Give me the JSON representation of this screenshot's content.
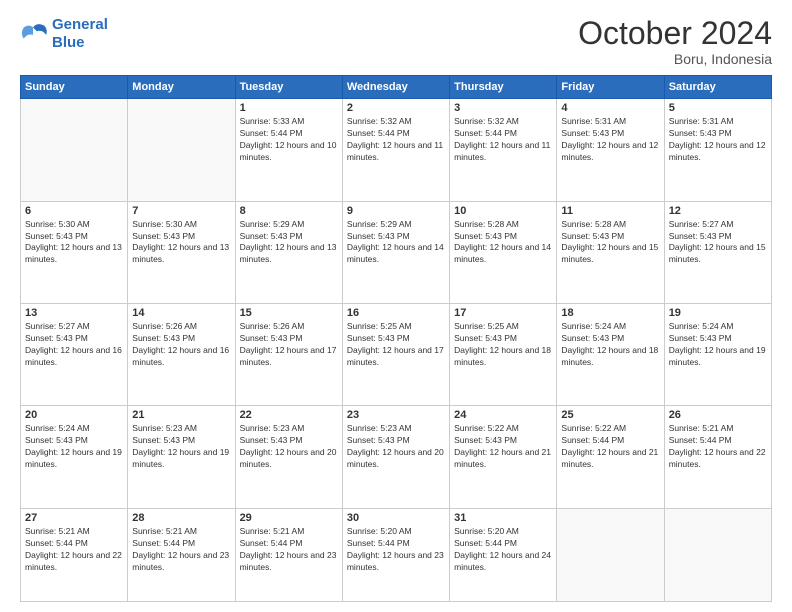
{
  "header": {
    "logo_line1": "General",
    "logo_line2": "Blue",
    "month_title": "October 2024",
    "location": "Boru, Indonesia"
  },
  "days_of_week": [
    "Sunday",
    "Monday",
    "Tuesday",
    "Wednesday",
    "Thursday",
    "Friday",
    "Saturday"
  ],
  "weeks": [
    [
      {
        "day": "",
        "sunrise": "",
        "sunset": "",
        "daylight": ""
      },
      {
        "day": "",
        "sunrise": "",
        "sunset": "",
        "daylight": ""
      },
      {
        "day": "1",
        "sunrise": "Sunrise: 5:33 AM",
        "sunset": "Sunset: 5:44 PM",
        "daylight": "Daylight: 12 hours and 10 minutes."
      },
      {
        "day": "2",
        "sunrise": "Sunrise: 5:32 AM",
        "sunset": "Sunset: 5:44 PM",
        "daylight": "Daylight: 12 hours and 11 minutes."
      },
      {
        "day": "3",
        "sunrise": "Sunrise: 5:32 AM",
        "sunset": "Sunset: 5:44 PM",
        "daylight": "Daylight: 12 hours and 11 minutes."
      },
      {
        "day": "4",
        "sunrise": "Sunrise: 5:31 AM",
        "sunset": "Sunset: 5:43 PM",
        "daylight": "Daylight: 12 hours and 12 minutes."
      },
      {
        "day": "5",
        "sunrise": "Sunrise: 5:31 AM",
        "sunset": "Sunset: 5:43 PM",
        "daylight": "Daylight: 12 hours and 12 minutes."
      }
    ],
    [
      {
        "day": "6",
        "sunrise": "Sunrise: 5:30 AM",
        "sunset": "Sunset: 5:43 PM",
        "daylight": "Daylight: 12 hours and 13 minutes."
      },
      {
        "day": "7",
        "sunrise": "Sunrise: 5:30 AM",
        "sunset": "Sunset: 5:43 PM",
        "daylight": "Daylight: 12 hours and 13 minutes."
      },
      {
        "day": "8",
        "sunrise": "Sunrise: 5:29 AM",
        "sunset": "Sunset: 5:43 PM",
        "daylight": "Daylight: 12 hours and 13 minutes."
      },
      {
        "day": "9",
        "sunrise": "Sunrise: 5:29 AM",
        "sunset": "Sunset: 5:43 PM",
        "daylight": "Daylight: 12 hours and 14 minutes."
      },
      {
        "day": "10",
        "sunrise": "Sunrise: 5:28 AM",
        "sunset": "Sunset: 5:43 PM",
        "daylight": "Daylight: 12 hours and 14 minutes."
      },
      {
        "day": "11",
        "sunrise": "Sunrise: 5:28 AM",
        "sunset": "Sunset: 5:43 PM",
        "daylight": "Daylight: 12 hours and 15 minutes."
      },
      {
        "day": "12",
        "sunrise": "Sunrise: 5:27 AM",
        "sunset": "Sunset: 5:43 PM",
        "daylight": "Daylight: 12 hours and 15 minutes."
      }
    ],
    [
      {
        "day": "13",
        "sunrise": "Sunrise: 5:27 AM",
        "sunset": "Sunset: 5:43 PM",
        "daylight": "Daylight: 12 hours and 16 minutes."
      },
      {
        "day": "14",
        "sunrise": "Sunrise: 5:26 AM",
        "sunset": "Sunset: 5:43 PM",
        "daylight": "Daylight: 12 hours and 16 minutes."
      },
      {
        "day": "15",
        "sunrise": "Sunrise: 5:26 AM",
        "sunset": "Sunset: 5:43 PM",
        "daylight": "Daylight: 12 hours and 17 minutes."
      },
      {
        "day": "16",
        "sunrise": "Sunrise: 5:25 AM",
        "sunset": "Sunset: 5:43 PM",
        "daylight": "Daylight: 12 hours and 17 minutes."
      },
      {
        "day": "17",
        "sunrise": "Sunrise: 5:25 AM",
        "sunset": "Sunset: 5:43 PM",
        "daylight": "Daylight: 12 hours and 18 minutes."
      },
      {
        "day": "18",
        "sunrise": "Sunrise: 5:24 AM",
        "sunset": "Sunset: 5:43 PM",
        "daylight": "Daylight: 12 hours and 18 minutes."
      },
      {
        "day": "19",
        "sunrise": "Sunrise: 5:24 AM",
        "sunset": "Sunset: 5:43 PM",
        "daylight": "Daylight: 12 hours and 19 minutes."
      }
    ],
    [
      {
        "day": "20",
        "sunrise": "Sunrise: 5:24 AM",
        "sunset": "Sunset: 5:43 PM",
        "daylight": "Daylight: 12 hours and 19 minutes."
      },
      {
        "day": "21",
        "sunrise": "Sunrise: 5:23 AM",
        "sunset": "Sunset: 5:43 PM",
        "daylight": "Daylight: 12 hours and 19 minutes."
      },
      {
        "day": "22",
        "sunrise": "Sunrise: 5:23 AM",
        "sunset": "Sunset: 5:43 PM",
        "daylight": "Daylight: 12 hours and 20 minutes."
      },
      {
        "day": "23",
        "sunrise": "Sunrise: 5:23 AM",
        "sunset": "Sunset: 5:43 PM",
        "daylight": "Daylight: 12 hours and 20 minutes."
      },
      {
        "day": "24",
        "sunrise": "Sunrise: 5:22 AM",
        "sunset": "Sunset: 5:43 PM",
        "daylight": "Daylight: 12 hours and 21 minutes."
      },
      {
        "day": "25",
        "sunrise": "Sunrise: 5:22 AM",
        "sunset": "Sunset: 5:44 PM",
        "daylight": "Daylight: 12 hours and 21 minutes."
      },
      {
        "day": "26",
        "sunrise": "Sunrise: 5:21 AM",
        "sunset": "Sunset: 5:44 PM",
        "daylight": "Daylight: 12 hours and 22 minutes."
      }
    ],
    [
      {
        "day": "27",
        "sunrise": "Sunrise: 5:21 AM",
        "sunset": "Sunset: 5:44 PM",
        "daylight": "Daylight: 12 hours and 22 minutes."
      },
      {
        "day": "28",
        "sunrise": "Sunrise: 5:21 AM",
        "sunset": "Sunset: 5:44 PM",
        "daylight": "Daylight: 12 hours and 23 minutes."
      },
      {
        "day": "29",
        "sunrise": "Sunrise: 5:21 AM",
        "sunset": "Sunset: 5:44 PM",
        "daylight": "Daylight: 12 hours and 23 minutes."
      },
      {
        "day": "30",
        "sunrise": "Sunrise: 5:20 AM",
        "sunset": "Sunset: 5:44 PM",
        "daylight": "Daylight: 12 hours and 23 minutes."
      },
      {
        "day": "31",
        "sunrise": "Sunrise: 5:20 AM",
        "sunset": "Sunset: 5:44 PM",
        "daylight": "Daylight: 12 hours and 24 minutes."
      },
      {
        "day": "",
        "sunrise": "",
        "sunset": "",
        "daylight": ""
      },
      {
        "day": "",
        "sunrise": "",
        "sunset": "",
        "daylight": ""
      }
    ]
  ]
}
